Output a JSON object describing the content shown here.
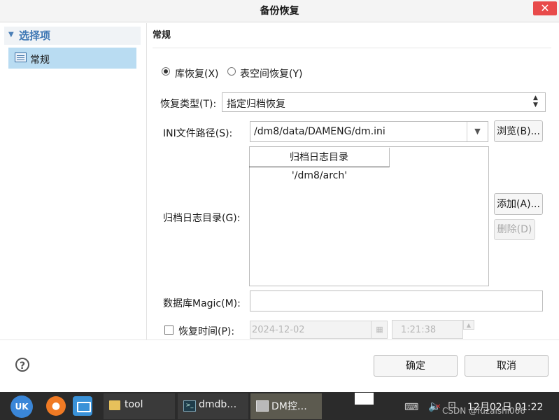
{
  "window": {
    "title": "备份恢复",
    "close_glyph": "✕"
  },
  "nav": {
    "header": "选择项",
    "items": [
      {
        "label": "常规",
        "selected": true
      }
    ]
  },
  "main": {
    "section_title": "常规",
    "restore_mode": {
      "options": [
        {
          "label": "库恢复(X)",
          "checked": true
        },
        {
          "label": "表空间恢复(Y)",
          "checked": false
        }
      ]
    },
    "restore_type": {
      "label": "恢复类型(T):",
      "value": "指定归档恢复"
    },
    "ini_path": {
      "label": "INI文件路径(S):",
      "value": "/dm8/data/DAMENG/dm.ini",
      "browse_label": "浏览(B)..."
    },
    "archive": {
      "label": "归档日志目录(G):",
      "column_header": "归档日志目录",
      "rows": [
        "'/dm8/arch'"
      ],
      "add_label": "添加(A)...",
      "delete_label": "删除(D)"
    },
    "magic": {
      "label": "数据库Magic(M):",
      "value": ""
    },
    "restore_time": {
      "label": "恢复时间(P):",
      "date": "2024-12-02",
      "time": "1:21:38",
      "checked": false
    }
  },
  "footer": {
    "help_glyph": "?",
    "ok_label": "确定",
    "cancel_label": "取消"
  },
  "taskbar": {
    "apps": [
      {
        "label": "tool"
      },
      {
        "label": "dmdb…"
      },
      {
        "label": "DM控…"
      }
    ],
    "clock": "12月02日 01:22",
    "watermark": "CSDN @fuzaishi066"
  }
}
